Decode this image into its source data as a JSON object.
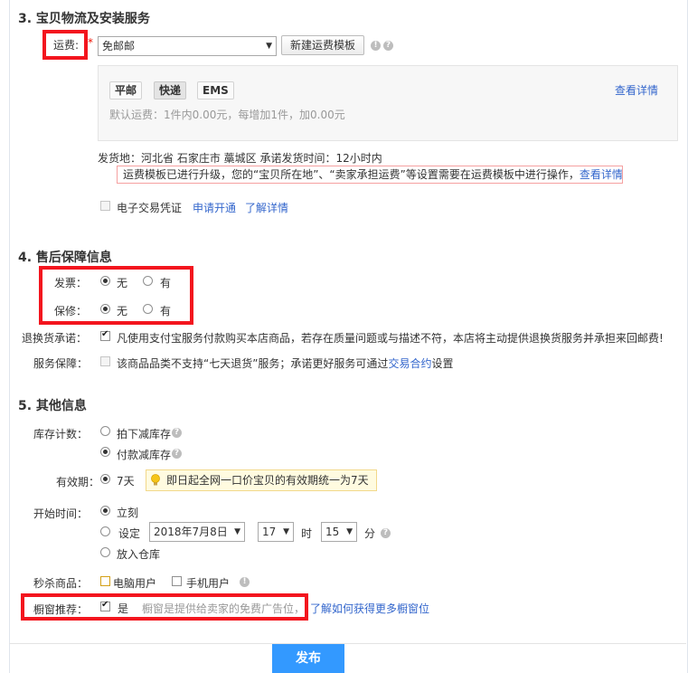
{
  "sections": {
    "logistics": "3. 宝贝物流及安装服务",
    "after_sales": "4. 售后保障信息",
    "other": "5. 其他信息"
  },
  "shipping": {
    "label": "运费:",
    "required_mark": "*",
    "select_value": "免邮邮",
    "new_template_button": "新建运费模板",
    "tabs": [
      "平邮",
      "快递",
      "EMS"
    ],
    "selected_tab": "快递",
    "view_details": "查看详情",
    "default_fee": "默认运费：1件内0.00元，每增加1件，加0.00元",
    "origin": "发货地：河北省 石家庄市 藁城区 承诺发货时间：12小时内",
    "notice": "运费模板已进行升级，您的“宝贝所在地”、“卖家承担运费”等设置需要在运费模板中进行操作，",
    "notice_link": "查看详情",
    "e_voucher_label": "电子交易凭证",
    "apply_link": "申请开通",
    "learn_link": "了解详情"
  },
  "after_sales": {
    "invoice_label": "发票：",
    "warranty_label": "保修：",
    "opt_no": "无",
    "opt_yes": "有",
    "return_label": "退换货承诺：",
    "return_text": "凡使用支付宝服务付款购买本店商品，若存在质量问题或与描述不符，本店将主动提供退换货服务并承担来回邮费!",
    "guarantee_label": "服务保障：",
    "guarantee_text": "该商品品类不支持“七天退货”服务；承诺更好服务可通过",
    "guarantee_link": "交易合约",
    "guarantee_suffix": "设置"
  },
  "other": {
    "stock_label": "库存计数：",
    "stock_opt1": "拍下减库存",
    "stock_opt2": "付款减库存",
    "validity_label": "有效期：",
    "validity_value": "7天",
    "validity_tip": "即日起全网一口价宝贝的有效期统一为7天",
    "start_label": "开始时间：",
    "start_now": "立刻",
    "start_set": "设定",
    "date_value": "2018年7月8日",
    "hour_value": "17",
    "hour_unit": "时",
    "minute_value": "15",
    "minute_unit": "分",
    "warehouse": "放入仓库",
    "flash_label": "秒杀商品：",
    "pc_user": "电脑用户",
    "mobile_user": "手机用户",
    "window_label": "橱窗推荐：",
    "window_yes": "是",
    "window_desc": "橱窗是提供给卖家的免费广告位，",
    "window_link": "了解如何获得更多橱窗位",
    "publish": "发布"
  },
  "colors": {
    "accent": "#3399ff",
    "link": "#3366cc",
    "highlight_box": "#f3151e"
  }
}
